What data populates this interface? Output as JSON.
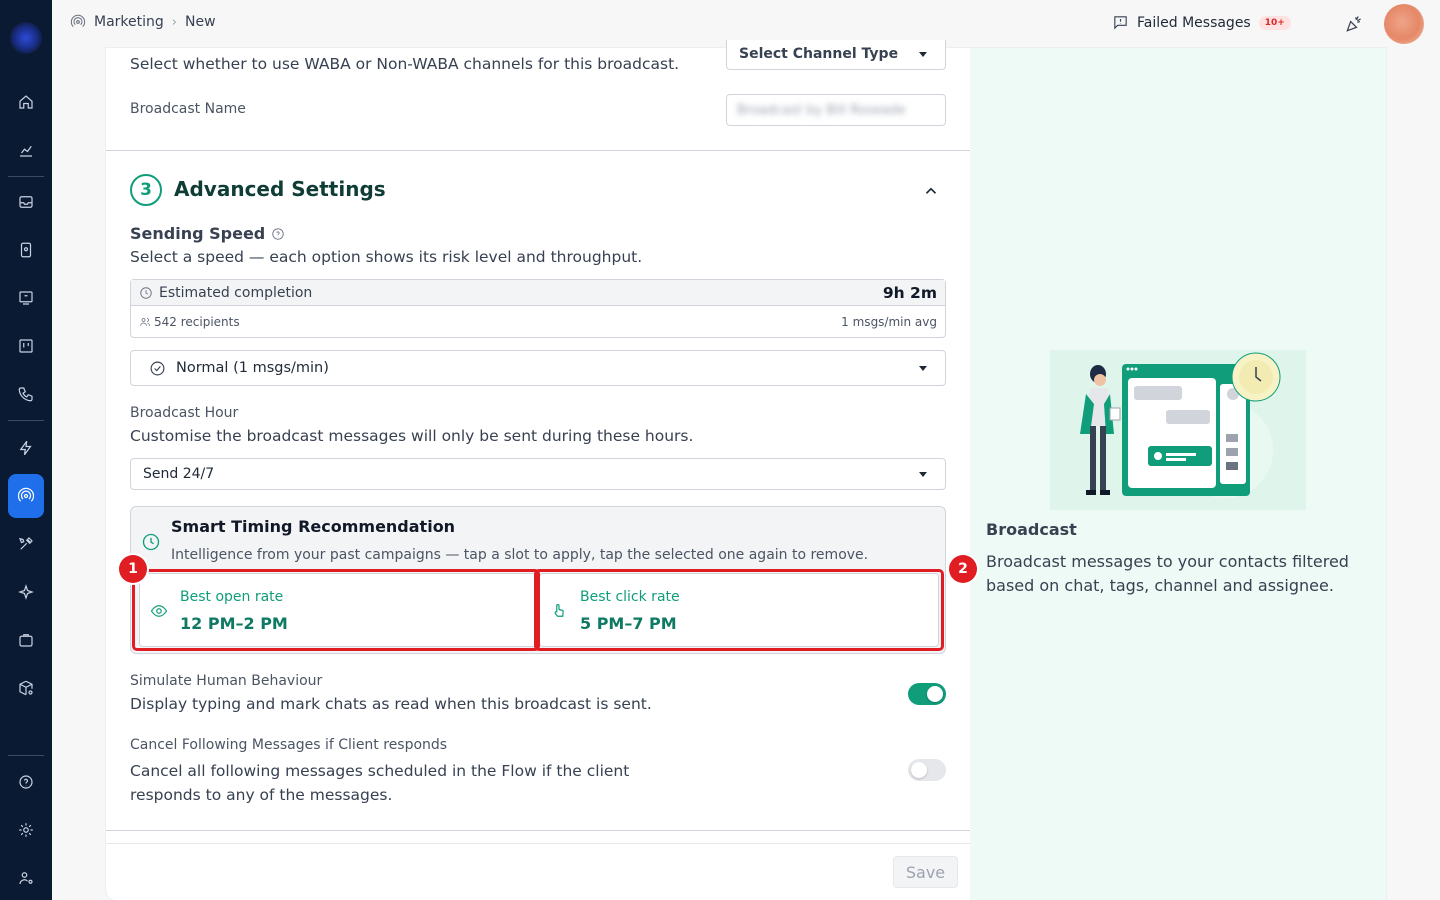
{
  "topbar": {
    "breadcrumb": [
      "Marketing",
      "New"
    ],
    "failed_label": "Failed Messages",
    "failed_badge": "10+"
  },
  "channel": {
    "description": "Select whether to use WABA or Non-WABA channels for this broadcast.",
    "select_label": "Select Channel Type"
  },
  "broadcast_name": {
    "label": "Broadcast Name",
    "value": "Broadcast by Bill Roseade"
  },
  "advanced": {
    "step": "3",
    "title": "Advanced Settings"
  },
  "speed": {
    "title": "Sending Speed",
    "description": "Select a speed — each option shows its risk level and throughput.",
    "est_label": "Estimated completion",
    "est_value": "9h 2m",
    "recipients": "542 recipients",
    "rate": "1 msgs/min avg",
    "selected": "Normal (1 msgs/min)"
  },
  "hour": {
    "label": "Broadcast Hour",
    "description": "Customise the broadcast messages will only be sent during these hours.",
    "selected": "Send 24/7"
  },
  "smart": {
    "title": "Smart Timing Recommendation",
    "description": "Intelligence from your past campaigns — tap a slot to apply, tap the selected one again to remove.",
    "slots": [
      {
        "label": "Best open rate",
        "value": "12 PM–2 PM"
      },
      {
        "label": "Best click rate",
        "value": "5 PM–7 PM"
      }
    ],
    "markers": [
      "1",
      "2"
    ]
  },
  "human": {
    "label": "Simulate Human Behaviour",
    "description": "Display typing and mark chats as read when this broadcast is sent.",
    "enabled": true
  },
  "cancel": {
    "label": "Cancel Following Messages if Client responds",
    "description": "Cancel all following messages scheduled in the Flow if the client responds to any of the messages.",
    "enabled": false
  },
  "footer": {
    "save_label": "Save"
  },
  "info": {
    "title": "Broadcast",
    "description": "Broadcast messages to your contacts filtered based on chat, tags, channel and assignee."
  },
  "colors": {
    "accent": "#0f9d7a",
    "highlight": "#e11d24",
    "sidebar": "#0b1a33"
  }
}
